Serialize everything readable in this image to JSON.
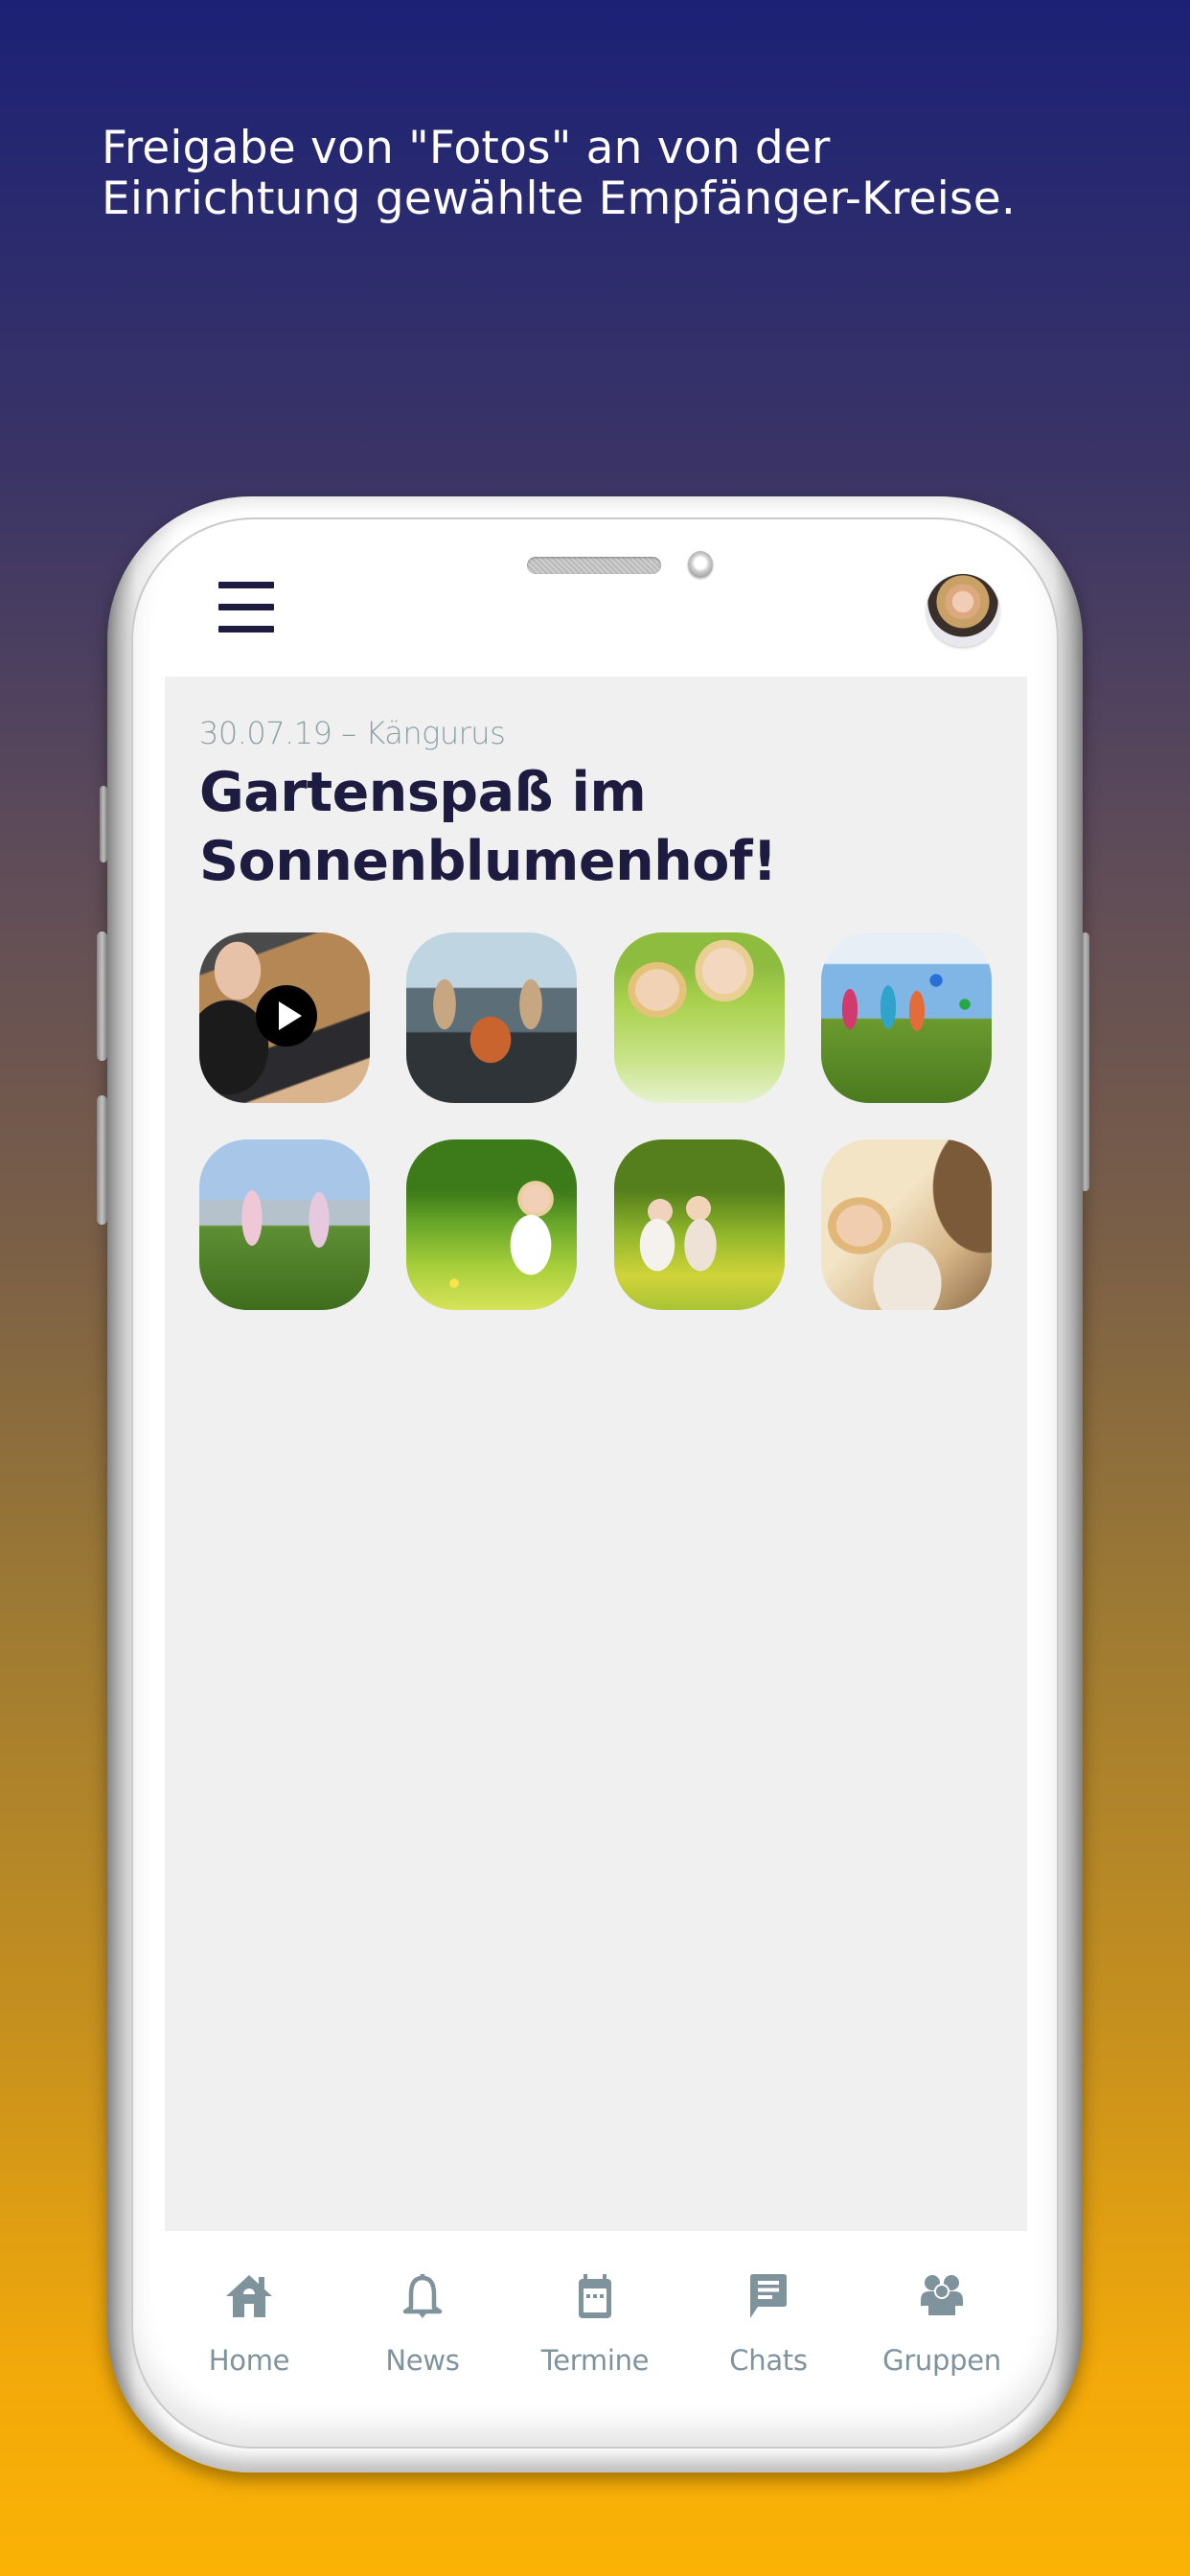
{
  "headline": {
    "line1": "Freigabe von \"Fotos\" an von der",
    "line2": "Einrichtung gewählte Empfänger-Kreise."
  },
  "colors": {
    "background_top": "#1c2176",
    "background_bottom": "#fbb205",
    "title": "#1e1b40",
    "meta": "#8fa0a5",
    "nav": "#7f939c",
    "content_bg": "#f0f0f0"
  },
  "header": {
    "menu_icon": "hamburger-menu-icon",
    "avatar": "user-avatar"
  },
  "post": {
    "meta": "30.07.19 – Kängurus",
    "title": "Gartenspaß im Sonnenblumenhof!",
    "media": [
      {
        "type": "video",
        "subject": "woman at laptop",
        "icon": "play-icon"
      },
      {
        "type": "photo",
        "subject": "kangaroo figurines and flower pot"
      },
      {
        "type": "photo",
        "subject": "two children lying in grass"
      },
      {
        "type": "photo",
        "subject": "children running with balloons"
      },
      {
        "type": "photo",
        "subject": "two girls running on lawn"
      },
      {
        "type": "photo",
        "subject": "girl with dandelion in meadow"
      },
      {
        "type": "photo",
        "subject": "two children blowing bubbles"
      },
      {
        "type": "photo",
        "subject": "girl peeking behind tree"
      }
    ]
  },
  "nav": {
    "items": [
      {
        "label": "Home",
        "icon": "home-icon"
      },
      {
        "label": "News",
        "icon": "bell-icon"
      },
      {
        "label": "Termine",
        "icon": "calendar-icon"
      },
      {
        "label": "Chats",
        "icon": "chat-icon"
      },
      {
        "label": "Gruppen",
        "icon": "group-icon"
      }
    ]
  }
}
